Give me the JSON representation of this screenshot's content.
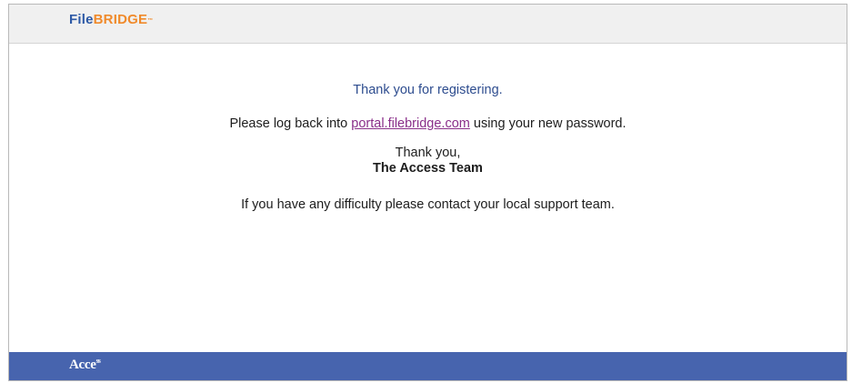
{
  "header": {
    "logo_part1": "File",
    "logo_part2": "BRIDGE",
    "logo_trademark": "™",
    "colors": {
      "logo_file": "#2e5aa6",
      "logo_bridge": "#f08a2b",
      "bar": "#f0f0f0"
    }
  },
  "message": {
    "heading": "Thank you for registering.",
    "login_prefix": "Please log back into ",
    "portal_link": "portal.filebridge.com",
    "login_suffix": " using your new password.",
    "signoff_line1": "Thank you,",
    "signoff_line2": "The Access Team",
    "support": "If you have any difficulty please contact your local support team.",
    "colors": {
      "heading": "#2e4d8f",
      "link": "#8a2f8a",
      "text": "#1d1d1d"
    }
  },
  "footer": {
    "logo_text": "Acce",
    "logo_mark": "ss",
    "colors": {
      "bar": "#4764ae",
      "logo": "#ffffff"
    }
  }
}
